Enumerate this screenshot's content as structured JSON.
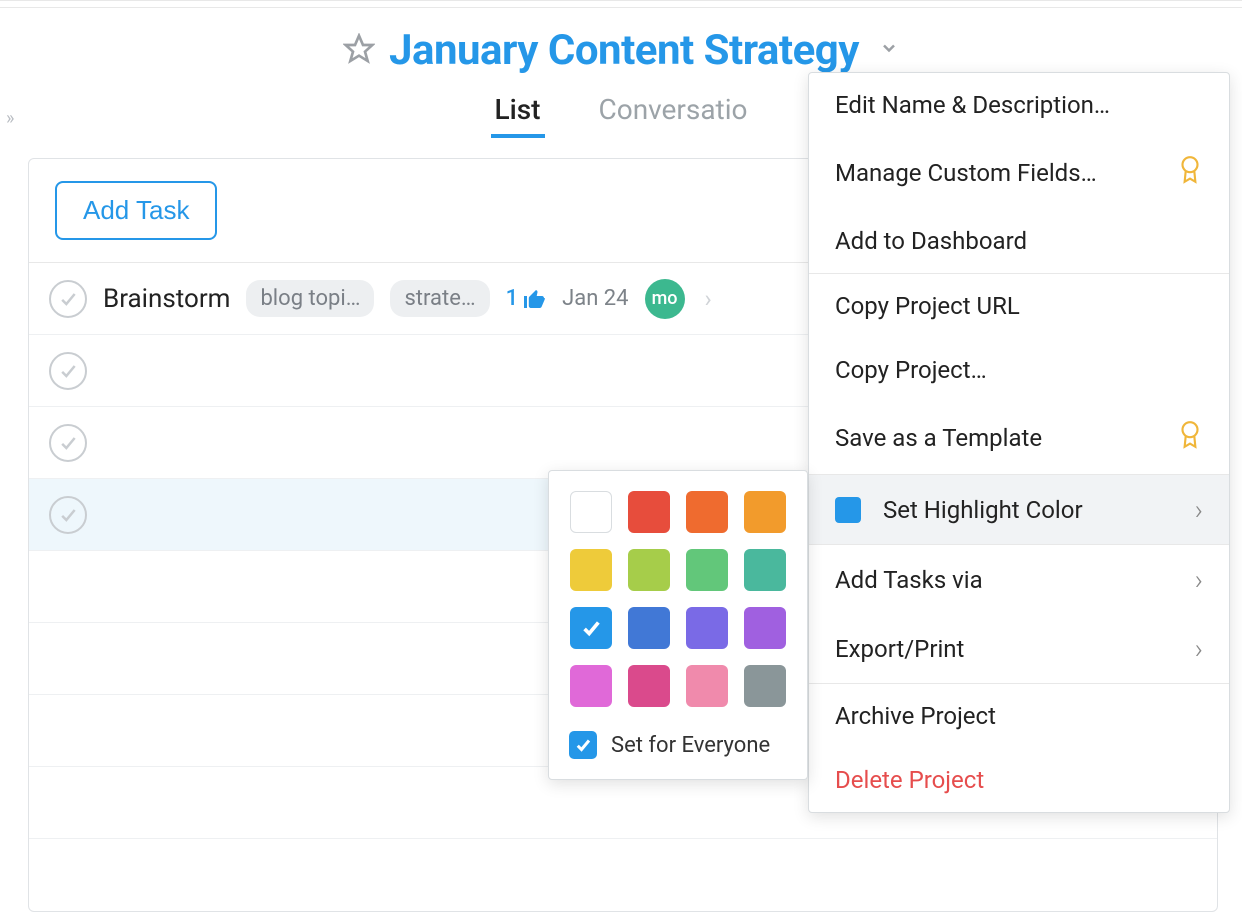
{
  "header": {
    "project_title": "January Content Strategy"
  },
  "tabs": {
    "list": "List",
    "conversations": "Conversatio"
  },
  "toolbar": {
    "add_task": "Add Task"
  },
  "tasks": [
    {
      "name": "Brainstorm",
      "tags": [
        "blog topi…",
        "strate…"
      ],
      "likes": "1",
      "date": "Jan 24",
      "avatar": "mo"
    }
  ],
  "menu": {
    "edit_name": "Edit Name & Description…",
    "manage_fields": "Manage Custom Fields…",
    "add_dashboard": "Add to Dashboard",
    "copy_url": "Copy Project URL",
    "copy_project": "Copy Project…",
    "save_template": "Save as a Template",
    "highlight_color": "Set Highlight Color",
    "add_tasks_via": "Add Tasks via",
    "export_print": "Export/Print",
    "archive": "Archive Project",
    "delete": "Delete Project"
  },
  "color_picker": {
    "set_everyone": "Set for Everyone",
    "selected": "#2597e8",
    "colors": [
      "none",
      "#e74d3c",
      "#ef6b2f",
      "#f29b2c",
      "#eecb3a",
      "#a6cd4a",
      "#62c77a",
      "#4ab89d",
      "#2597e8",
      "#4178d6",
      "#7a6ae6",
      "#a060e0",
      "#e069d8",
      "#da4a8c",
      "#f08aac",
      "#8a9699"
    ]
  }
}
